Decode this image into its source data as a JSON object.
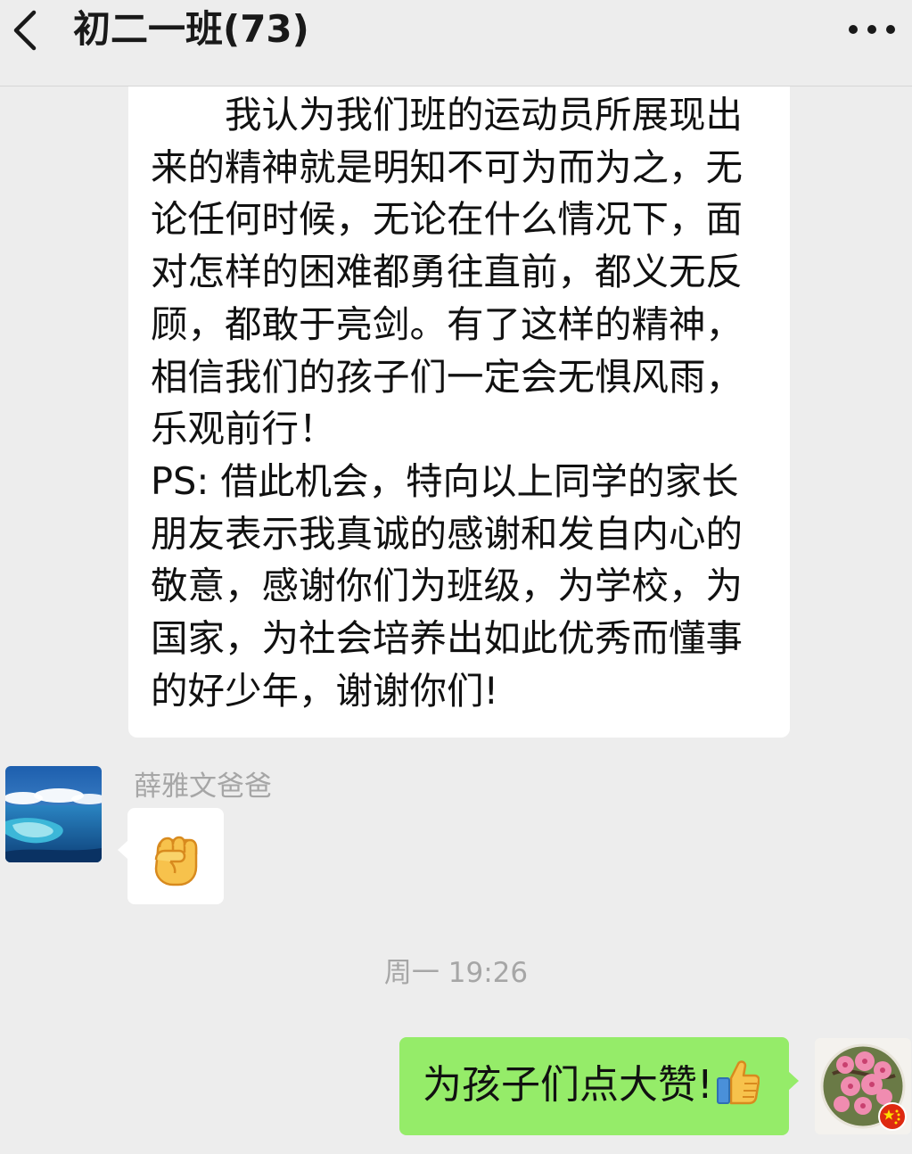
{
  "header": {
    "back_icon": "chevron-left-icon",
    "title": "初二一班(73)",
    "more_icon": "more-dots-icon"
  },
  "messages": {
    "long_message": {
      "text": "　　我认为我们班的运动员所展现出来的精神就是明知不可为而为之，无论任何时候，无论在什么情况下，面对怎样的困难都勇往直前，都义无反顾，都敢于亮剑。有了这样的精神，相信我们的孩子们一定会无惧风雨，乐观前行！\nPS: 借此机会，特向以上同学的家长朋友表示我真诚的感谢和发自内心的敬意，感谢你们为班级，为学校，为国家，为社会培养出如此优秀而懂事的好少年，谢谢你们!"
    },
    "reply": {
      "sender_name": "薛雅文爸爸",
      "avatar": "ocean-island-avatar",
      "sticker_icon": "raised-fist-icon"
    },
    "timestamp": "周一 19:26",
    "sent": {
      "text": "为孩子们点大赞!",
      "emoji_icon": "thumbs-up-icon",
      "avatar": "peach-blossom-avatar"
    }
  },
  "colors": {
    "background": "#ededed",
    "bubble_received": "#ffffff",
    "bubble_sent": "#95ec69",
    "meta_text": "#a6a6a6"
  }
}
